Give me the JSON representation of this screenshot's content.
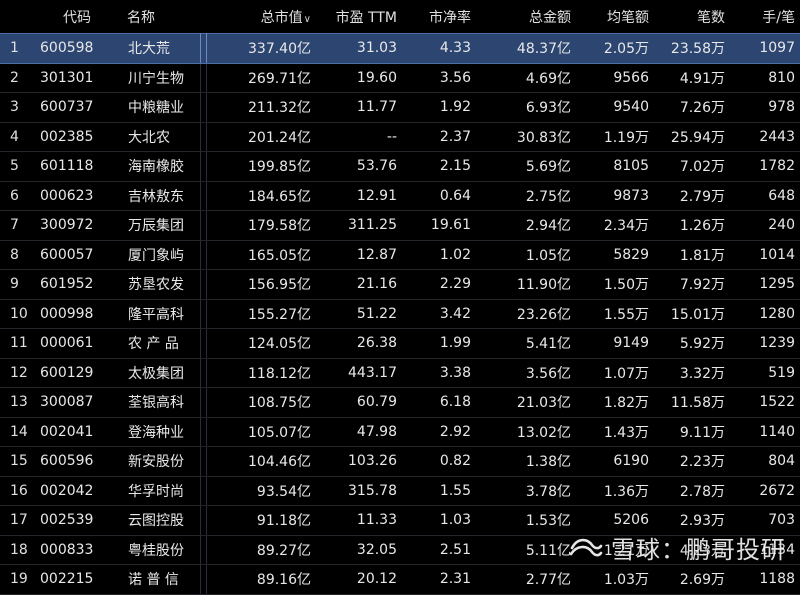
{
  "table": {
    "headers": {
      "code": "代码",
      "name": "名称",
      "market_cap": "总市值",
      "pe": "市盈 TTM",
      "pb": "市净率",
      "amount": "总金额",
      "avg_amount": "均笔额",
      "count": "笔数",
      "ratio": "手/笔"
    },
    "sort_icon": "sort-desc-icon",
    "selected_row": 0,
    "rows": [
      {
        "idx": "1",
        "code": "600598",
        "name": "北大荒",
        "cap": "337.40亿",
        "pe": "31.03",
        "pb": "4.33",
        "amt": "48.37亿",
        "avg": "2.05万",
        "cnt": "23.58万",
        "ratio": "1097"
      },
      {
        "idx": "2",
        "code": "301301",
        "name": "川宁生物",
        "cap": "269.71亿",
        "pe": "19.60",
        "pb": "3.56",
        "amt": "4.69亿",
        "avg": "9566",
        "cnt": "4.91万",
        "ratio": "810"
      },
      {
        "idx": "3",
        "code": "600737",
        "name": "中粮糖业",
        "cap": "211.32亿",
        "pe": "11.77",
        "pb": "1.92",
        "amt": "6.93亿",
        "avg": "9540",
        "cnt": "7.26万",
        "ratio": "978"
      },
      {
        "idx": "4",
        "code": "002385",
        "name": "大北农",
        "cap": "201.24亿",
        "pe": "--",
        "pb": "2.37",
        "amt": "30.83亿",
        "avg": "1.19万",
        "cnt": "25.94万",
        "ratio": "2443"
      },
      {
        "idx": "5",
        "code": "601118",
        "name": "海南橡胶",
        "cap": "199.85亿",
        "pe": "53.76",
        "pb": "2.15",
        "amt": "5.69亿",
        "avg": "8105",
        "cnt": "7.02万",
        "ratio": "1782"
      },
      {
        "idx": "6",
        "code": "000623",
        "name": "吉林敖东",
        "cap": "184.65亿",
        "pe": "12.91",
        "pb": "0.64",
        "amt": "2.75亿",
        "avg": "9873",
        "cnt": "2.79万",
        "ratio": "648"
      },
      {
        "idx": "7",
        "code": "300972",
        "name": "万辰集团",
        "cap": "179.58亿",
        "pe": "311.25",
        "pb": "19.61",
        "amt": "2.94亿",
        "avg": "2.34万",
        "cnt": "1.26万",
        "ratio": "240"
      },
      {
        "idx": "8",
        "code": "600057",
        "name": "厦门象屿",
        "cap": "165.05亿",
        "pe": "12.87",
        "pb": "1.02",
        "amt": "1.05亿",
        "avg": "5829",
        "cnt": "1.81万",
        "ratio": "1014"
      },
      {
        "idx": "9",
        "code": "601952",
        "name": "苏垦农发",
        "cap": "156.95亿",
        "pe": "21.16",
        "pb": "2.29",
        "amt": "11.90亿",
        "avg": "1.50万",
        "cnt": "7.92万",
        "ratio": "1295"
      },
      {
        "idx": "10",
        "code": "000998",
        "name": "隆平高科",
        "cap": "155.27亿",
        "pe": "51.22",
        "pb": "3.42",
        "amt": "23.26亿",
        "avg": "1.55万",
        "cnt": "15.01万",
        "ratio": "1280"
      },
      {
        "idx": "11",
        "code": "000061",
        "name": "农 产 品",
        "cap": "124.05亿",
        "pe": "26.38",
        "pb": "1.99",
        "amt": "5.41亿",
        "avg": "9149",
        "cnt": "5.92万",
        "ratio": "1239"
      },
      {
        "idx": "12",
        "code": "600129",
        "name": "太极集团",
        "cap": "118.12亿",
        "pe": "443.17",
        "pb": "3.38",
        "amt": "3.56亿",
        "avg": "1.07万",
        "cnt": "3.32万",
        "ratio": "519"
      },
      {
        "idx": "13",
        "code": "300087",
        "name": "荃银高科",
        "cap": "108.75亿",
        "pe": "60.79",
        "pb": "6.18",
        "amt": "21.03亿",
        "avg": "1.82万",
        "cnt": "11.58万",
        "ratio": "1522"
      },
      {
        "idx": "14",
        "code": "002041",
        "name": "登海种业",
        "cap": "105.07亿",
        "pe": "47.98",
        "pb": "2.92",
        "amt": "13.02亿",
        "avg": "1.43万",
        "cnt": "9.11万",
        "ratio": "1140"
      },
      {
        "idx": "15",
        "code": "600596",
        "name": "新安股份",
        "cap": "104.46亿",
        "pe": "103.26",
        "pb": "0.82",
        "amt": "1.38亿",
        "avg": "6190",
        "cnt": "2.23万",
        "ratio": "804"
      },
      {
        "idx": "16",
        "code": "002042",
        "name": "华孚时尚",
        "cap": "93.54亿",
        "pe": "315.78",
        "pb": "1.55",
        "amt": "3.78亿",
        "avg": "1.36万",
        "cnt": "2.78万",
        "ratio": "2672"
      },
      {
        "idx": "17",
        "code": "002539",
        "name": "云图控股",
        "cap": "91.18亿",
        "pe": "11.33",
        "pb": "1.03",
        "amt": "1.53亿",
        "avg": "5206",
        "cnt": "2.93万",
        "ratio": "703"
      },
      {
        "idx": "18",
        "code": "000833",
        "name": "粤桂股份",
        "cap": "89.27亿",
        "pe": "32.05",
        "pb": "2.51",
        "amt": "5.11亿",
        "avg": "1.21万",
        "cnt": "4.23万",
        "ratio": "1134"
      },
      {
        "idx": "19",
        "code": "002215",
        "name": "诺 普 信",
        "cap": "89.16亿",
        "pe": "20.12",
        "pb": "2.31",
        "amt": "2.77亿",
        "avg": "1.03万",
        "cnt": "2.69万",
        "ratio": "1188"
      }
    ]
  },
  "watermark": {
    "text": "雪球：鹏哥投研",
    "icon": "snowball-logo-icon"
  },
  "colors": {
    "background": "#000000",
    "selected_row": "#2c4571",
    "grid_line": "#23252b",
    "text": "#e8e8e8"
  }
}
